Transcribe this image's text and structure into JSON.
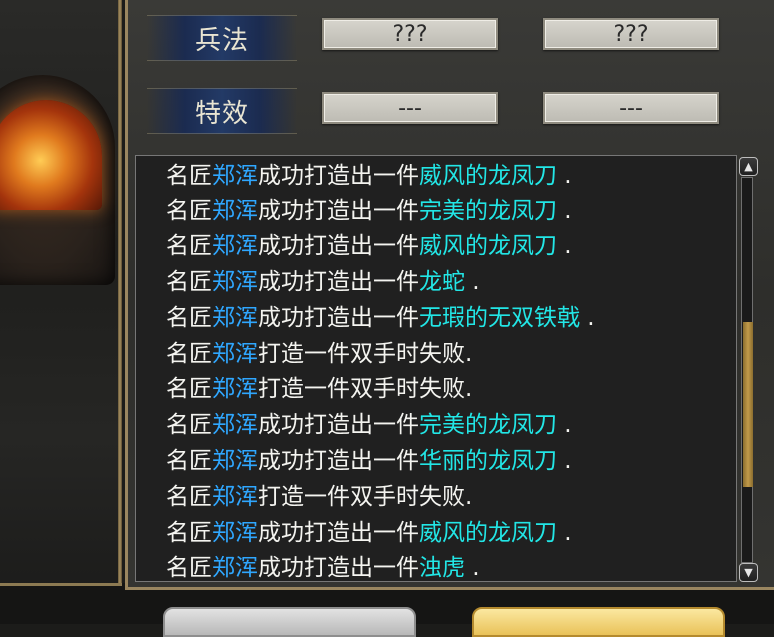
{
  "rows": [
    {
      "label": "兵法",
      "values": [
        "???",
        "???"
      ]
    },
    {
      "label": "特效",
      "values": [
        "---",
        "---"
      ]
    }
  ],
  "log": [
    {
      "prefix": "名匠",
      "name": "郑浑",
      "action": "成功打造出一件",
      "item": "威风的龙凤刀",
      "suffix": " ."
    },
    {
      "prefix": "名匠",
      "name": "郑浑",
      "action": "成功打造出一件",
      "item": "完美的龙凤刀",
      "suffix": " ."
    },
    {
      "prefix": "名匠",
      "name": "郑浑",
      "action": "成功打造出一件",
      "item": "威风的龙凤刀",
      "suffix": " ."
    },
    {
      "prefix": "名匠",
      "name": "郑浑",
      "action": "成功打造出一件",
      "item": "龙蛇",
      "suffix": " ."
    },
    {
      "prefix": "名匠",
      "name": "郑浑",
      "action": "成功打造出一件",
      "item": "无瑕的无双铁戟",
      "suffix": " ."
    },
    {
      "prefix": "名匠",
      "name": "郑浑",
      "action": "打造一件双手时失败.",
      "item": "",
      "suffix": ""
    },
    {
      "prefix": "名匠",
      "name": "郑浑",
      "action": "打造一件双手时失败.",
      "item": "",
      "suffix": ""
    },
    {
      "prefix": "名匠",
      "name": "郑浑",
      "action": "成功打造出一件",
      "item": "完美的龙凤刀",
      "suffix": " ."
    },
    {
      "prefix": "名匠",
      "name": "郑浑",
      "action": "成功打造出一件",
      "item": "华丽的龙凤刀",
      "suffix": " ."
    },
    {
      "prefix": "名匠",
      "name": "郑浑",
      "action": "打造一件双手时失败.",
      "item": "",
      "suffix": ""
    },
    {
      "prefix": "名匠",
      "name": "郑浑",
      "action": "成功打造出一件",
      "item": "威风的龙凤刀",
      "suffix": " ."
    },
    {
      "prefix": "名匠",
      "name": "郑浑",
      "action": "成功打造出一件",
      "item": "浊虎",
      "suffix": " ."
    }
  ],
  "scrollbar": {
    "up_icon": "scroll-up-arrow",
    "down_icon": "scroll-down-arrow",
    "position": 0.38,
    "visible_fraction": 0.45
  },
  "colors": {
    "name": "#2fa7ff",
    "item": "#22e6e6",
    "text": "#f4f4f0",
    "accent_gold": "#e9c259"
  }
}
